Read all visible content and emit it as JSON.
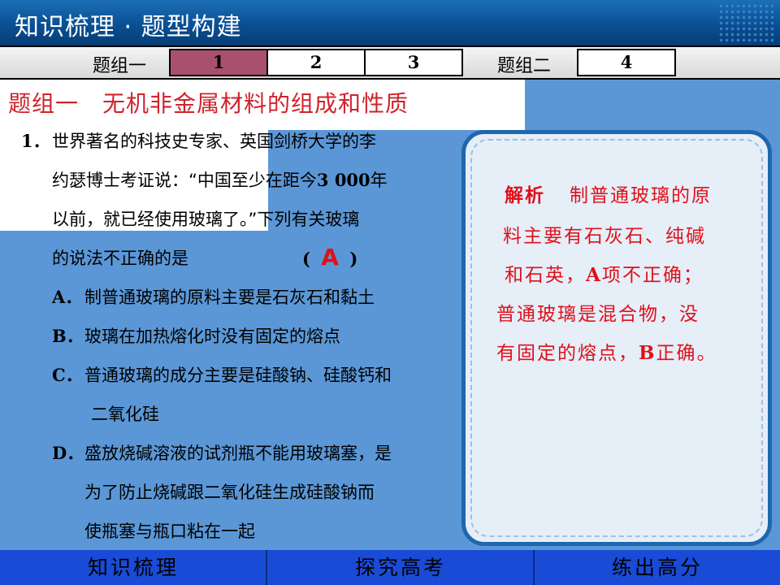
{
  "header": {
    "title": "知识梳理 · 题型构建"
  },
  "tabs": {
    "group1_label": "题组一",
    "group2_label": "题组二",
    "items": [
      "1",
      "2",
      "3",
      "4"
    ],
    "active_index": 0
  },
  "section_heading": "题组一　无机非金属材料的组成和性质",
  "question": {
    "number": "1．",
    "line1": "世界著名的科技史专家、英国剑桥大学的李",
    "line2_a": "约瑟博士考证说：“中国至少在距今",
    "line2_num": "3 000",
    "line2_b": "年",
    "line3": "以前，就已经使用玻璃了。”下列有关玻璃",
    "line4": "的说法不正确的是",
    "paren_open": "(",
    "answer": "A",
    "paren_close": ")",
    "options": [
      {
        "letter": "A．",
        "lines": [
          "制普通玻璃的原料主要是石灰石和黏土"
        ]
      },
      {
        "letter": "B．",
        "lines": [
          "玻璃在加热熔化时没有固定的熔点"
        ]
      },
      {
        "letter": "C．",
        "lines": [
          "普通玻璃的成分主要是硅酸钠、硅酸钙和",
          "二氧化硅"
        ]
      },
      {
        "letter": "D．",
        "lines": [
          "盛放烧碱溶液的试剂瓶不能用玻璃塞，是",
          "为了防止烧碱跟二氧化硅生成硅酸钠而",
          "使瓶塞与瓶口粘在一起"
        ]
      }
    ]
  },
  "analysis": {
    "label": "解析",
    "line1": "制普通玻璃的原",
    "line2": "料主要有石灰石、纯碱",
    "line3_a": "和石英，",
    "line3_b": "A",
    "line3_c": "项不正确；",
    "line4": "普通玻璃是混合物，没",
    "line5_a": "有固定的熔点，",
    "line5_b": "B",
    "line5_c": "正确。"
  },
  "footer": {
    "items": [
      "知识梳理",
      "探究高考",
      "练出高分"
    ]
  },
  "colors": {
    "accent_red": "#e0101a",
    "active_tab": "#a9506e",
    "header_blue": "#0a4f93",
    "footer_blue": "#1a4bd6"
  }
}
